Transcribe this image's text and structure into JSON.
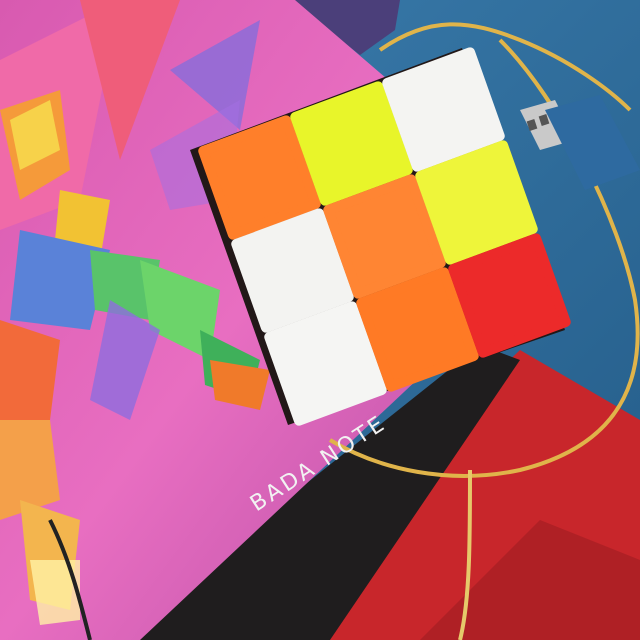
{
  "photo": {
    "book_cover_text": "BADA NOTE"
  },
  "cube": {
    "stickers": [
      {
        "row": 0,
        "col": 0,
        "color": "#ff7f2a",
        "name": "orange"
      },
      {
        "row": 0,
        "col": 1,
        "color": "#e8f52a",
        "name": "yellow"
      },
      {
        "row": 0,
        "col": 2,
        "color": "#f4f4f2",
        "name": "white"
      },
      {
        "row": 1,
        "col": 0,
        "color": "#f3f3f1",
        "name": "white"
      },
      {
        "row": 1,
        "col": 1,
        "color": "#ff8533",
        "name": "orange"
      },
      {
        "row": 1,
        "col": 2,
        "color": "#eef53a",
        "name": "yellow"
      },
      {
        "row": 2,
        "col": 0,
        "color": "#f5f5f3",
        "name": "white"
      },
      {
        "row": 2,
        "col": 1,
        "color": "#ff7a25",
        "name": "orange"
      },
      {
        "row": 2,
        "col": 2,
        "color": "#ec2a2a",
        "name": "red"
      }
    ]
  },
  "colors": {
    "pink_poster": "#e35fb4",
    "purple_poster": "#8a5ec9",
    "blue_cloth": "#2f6f9e",
    "red_cloth": "#c8262b",
    "black_band": "#1f1d1e",
    "wire_yellow": "#e0b44a"
  }
}
